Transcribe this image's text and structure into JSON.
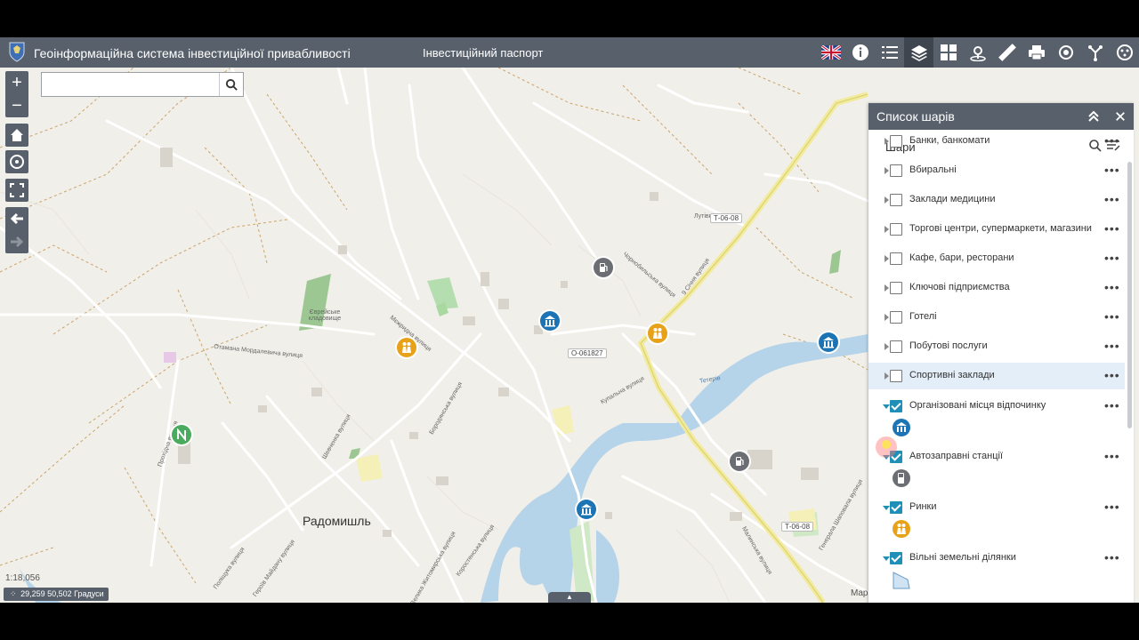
{
  "header": {
    "title": "Геоінформаційна система інвестиційної привабливості",
    "subtitle": "Інвестиційний паспорт"
  },
  "toolbar": {
    "items": [
      {
        "icon": "uk-flag-icon"
      },
      {
        "icon": "info-icon"
      },
      {
        "icon": "list-icon"
      },
      {
        "icon": "layers-icon",
        "active": true
      },
      {
        "icon": "grid-icon"
      },
      {
        "icon": "location-icon"
      },
      {
        "icon": "ruler-icon"
      },
      {
        "icon": "print-icon"
      },
      {
        "icon": "routing-icon"
      },
      {
        "icon": "share-icon"
      },
      {
        "icon": "gallery-icon"
      }
    ]
  },
  "search": {
    "placeholder": ""
  },
  "map": {
    "scale": "1:18,056",
    "coords": "29,259 50,502 Градуси",
    "town": "Радомишль",
    "attribution": "Map",
    "road_tags": [
      "Т-06-08",
      "О-061827",
      "Т-06-08"
    ],
    "area_labels": [
      "Єврейське кладовище",
      "Тетерів",
      "Лутівка",
      "Чорнобильська вулиця",
      "Мєжридна вулиця",
      "Бородянська вулиця",
      "Отамана Мордалевича вулиця",
      "9 Січня вулиця",
      "Купальна вулиця",
      "Прохідна вулиця",
      "Велика Житомирська вулиця",
      "Коростенська вулиця",
      "Шевченка вулиця",
      "Поліщука вулиця",
      "Героїв Майдану вулиця",
      "Малинська вулиця",
      "Генерала Шаповала вулиця"
    ]
  },
  "panel": {
    "title": "Список шарів",
    "section": "Шари",
    "layers": [
      {
        "label": "Банки, банкомати",
        "checked": false
      },
      {
        "label": "Вбиральні",
        "checked": false
      },
      {
        "label": "Заклади медицини",
        "checked": false
      },
      {
        "label": "Торгові центри, супермаркети, магазини",
        "checked": false
      },
      {
        "label": "Кафе, бари, ресторани",
        "checked": false
      },
      {
        "label": "Ключові підприємства",
        "checked": false
      },
      {
        "label": "Готелі",
        "checked": false
      },
      {
        "label": "Побутові послуги",
        "checked": false
      },
      {
        "label": "Спортивні заклади",
        "checked": false,
        "highlighted": true
      },
      {
        "label": "Організовані місця відпочинку",
        "checked": true,
        "legend": "building-icon"
      },
      {
        "label": "Автозаправні станції",
        "checked": true,
        "legend": "fuel-icon"
      },
      {
        "label": "Ринки",
        "checked": true,
        "legend": "people-icon"
      },
      {
        "label": "Вільні земельні ділянки",
        "checked": true,
        "legend": "polygon-icon"
      }
    ],
    "more": "•••"
  },
  "colors": {
    "header": "#58606b",
    "accent": "#1f8fb8",
    "marker_blue": "#1d74b5",
    "marker_orange": "#e8a21a",
    "marker_gray": "#6b6e72",
    "marker_green": "#4aaa5e"
  }
}
